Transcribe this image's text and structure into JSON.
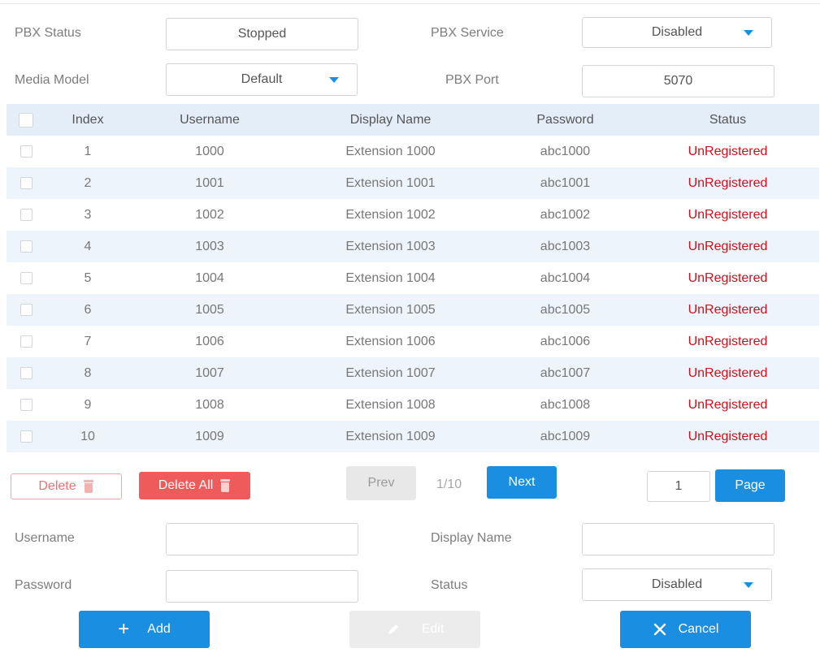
{
  "settings": {
    "pbx_status_label": "PBX Status",
    "pbx_status_value": "Stopped",
    "pbx_service_label": "PBX Service",
    "pbx_service_value": "Disabled",
    "media_model_label": "Media Model",
    "media_model_value": "Default",
    "pbx_port_label": "PBX Port",
    "pbx_port_value": "5070"
  },
  "table": {
    "headers": [
      "Index",
      "Username",
      "Display Name",
      "Password",
      "Status"
    ],
    "rows": [
      {
        "index": "1",
        "username": "1000",
        "display_name": "Extension 1000",
        "password": "abc1000",
        "status": "UnRegistered"
      },
      {
        "index": "2",
        "username": "1001",
        "display_name": "Extension 1001",
        "password": "abc1001",
        "status": "UnRegistered"
      },
      {
        "index": "3",
        "username": "1002",
        "display_name": "Extension 1002",
        "password": "abc1002",
        "status": "UnRegistered"
      },
      {
        "index": "4",
        "username": "1003",
        "display_name": "Extension 1003",
        "password": "abc1003",
        "status": "UnRegistered"
      },
      {
        "index": "5",
        "username": "1004",
        "display_name": "Extension 1004",
        "password": "abc1004",
        "status": "UnRegistered"
      },
      {
        "index": "6",
        "username": "1005",
        "display_name": "Extension 1005",
        "password": "abc1005",
        "status": "UnRegistered"
      },
      {
        "index": "7",
        "username": "1006",
        "display_name": "Extension 1006",
        "password": "abc1006",
        "status": "UnRegistered"
      },
      {
        "index": "8",
        "username": "1007",
        "display_name": "Extension 1007",
        "password": "abc1007",
        "status": "UnRegistered"
      },
      {
        "index": "9",
        "username": "1008",
        "display_name": "Extension 1008",
        "password": "abc1008",
        "status": "UnRegistered"
      },
      {
        "index": "10",
        "username": "1009",
        "display_name": "Extension 1009",
        "password": "abc1009",
        "status": "UnRegistered"
      }
    ]
  },
  "pagination": {
    "delete_label": "Delete",
    "delete_all_label": "Delete All",
    "prev_label": "Prev",
    "page_info": "1/10",
    "next_label": "Next",
    "page_input_value": "1",
    "page_button_label": "Page"
  },
  "form": {
    "username_label": "Username",
    "username_value": "",
    "display_name_label": "Display Name",
    "display_name_value": "",
    "password_label": "Password",
    "password_value": "",
    "status_label": "Status",
    "status_value": "Disabled",
    "add_label": "Add",
    "edit_label": "Edit",
    "cancel_label": "Cancel"
  },
  "colors": {
    "accent": "#1a8ee1",
    "danger": "#ef5a5a",
    "status_unregistered": "#d0101a",
    "row_alt": "#eef4fb",
    "header_bg": "#e4eef8"
  }
}
